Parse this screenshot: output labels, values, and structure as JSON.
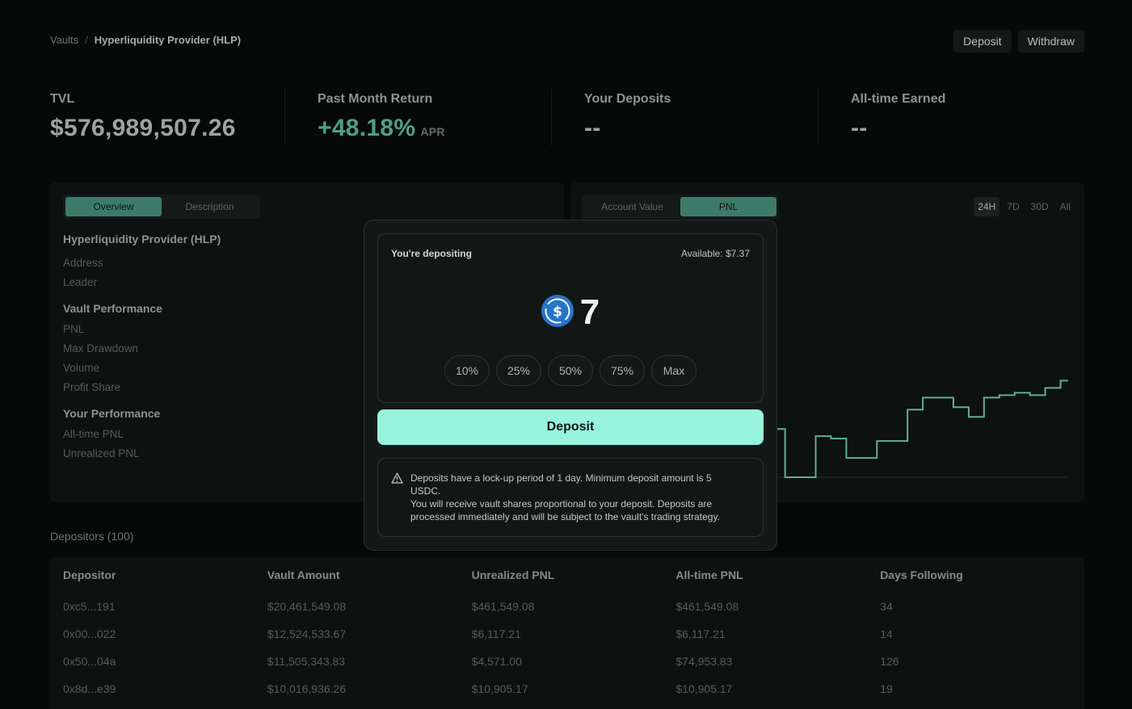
{
  "breadcrumb": {
    "root": "Vaults",
    "sep": "/",
    "current": "Hyperliquidity Provider (HLP)"
  },
  "top_actions": {
    "deposit": "Deposit",
    "withdraw": "Withdraw"
  },
  "stats": {
    "tvl": {
      "label": "TVL",
      "value": "$576,989,507.26"
    },
    "return": {
      "label": "Past Month Return",
      "value": "+48.18%",
      "unit": "APR"
    },
    "your_deposits": {
      "label": "Your Deposits",
      "value": "--"
    },
    "earned": {
      "label": "All-time Earned",
      "value": "--"
    }
  },
  "left_tabs": [
    "Overview",
    "Description"
  ],
  "info": {
    "title": "Hyperliquidity Provider (HLP)",
    "address": "Address",
    "leader": "Leader",
    "vault_perf": "Vault Performance",
    "pnl": "PNL",
    "max_drawdown": "Max Drawdown",
    "volume": "Volume",
    "profit_share": "Profit Share",
    "your_perf": "Your Performance",
    "alltime_pnl": "All-time PNL",
    "unrealized_pnl": "Unrealized PNL"
  },
  "chart_tabs": [
    "Account Value",
    "PNL"
  ],
  "range_tabs": [
    "24H",
    "7D",
    "30D",
    "All"
  ],
  "chart_data": {
    "type": "line",
    "series": [
      {
        "values": [
          0.92,
          0.93,
          0.94,
          0.95,
          0.97,
          0.99,
          1.0,
          0.97,
          0.98,
          0.95,
          0.75,
          0.72,
          0.6,
          0.2,
          0.0,
          0.0,
          0.17,
          0.16,
          0.08,
          0.08,
          0.15,
          0.15,
          0.28,
          0.33,
          0.33,
          0.29,
          0.25,
          0.33,
          0.34,
          0.35,
          0.34,
          0.37,
          0.4
        ]
      }
    ],
    "grid": false,
    "color": "#5fae95"
  },
  "depositors": {
    "title": "Depositors (100)",
    "columns": [
      "Depositor",
      "Vault Amount",
      "Unrealized PNL",
      "All-time PNL",
      "Days Following"
    ],
    "rows": [
      [
        "0xc5...191",
        "$20,461,549.08",
        "$461,549.08",
        "$461,549.08",
        "34"
      ],
      [
        "0x00...022",
        "$12,524,533.67",
        "$6,117.21",
        "$6,117.21",
        "14"
      ],
      [
        "0x50...04a",
        "$11,505,343.83",
        "$4,571.00",
        "$74,953.83",
        "126"
      ],
      [
        "0x8d...e39",
        "$10,016,936.26",
        "$10,905.17",
        "$10,905.17",
        "19"
      ]
    ]
  },
  "modal": {
    "label": "You're depositing",
    "available": "Available:  $7.37",
    "amount": "7",
    "token_icon": "usdc-icon",
    "percents": [
      "10%",
      "25%",
      "50%",
      "75%",
      "Max"
    ],
    "deposit_button": "Deposit",
    "notice_line1": "Deposits have a lock-up period of 1 day. Minimum deposit amount is 5 USDC.",
    "notice_line2": "You will receive vault shares proportional to your deposit. Deposits are processed immediately and will be subject to the vault's trading strategy."
  },
  "colors": {
    "accent": "#97f3dc",
    "green": "#4f9f86",
    "chart_line": "#5fae95"
  }
}
